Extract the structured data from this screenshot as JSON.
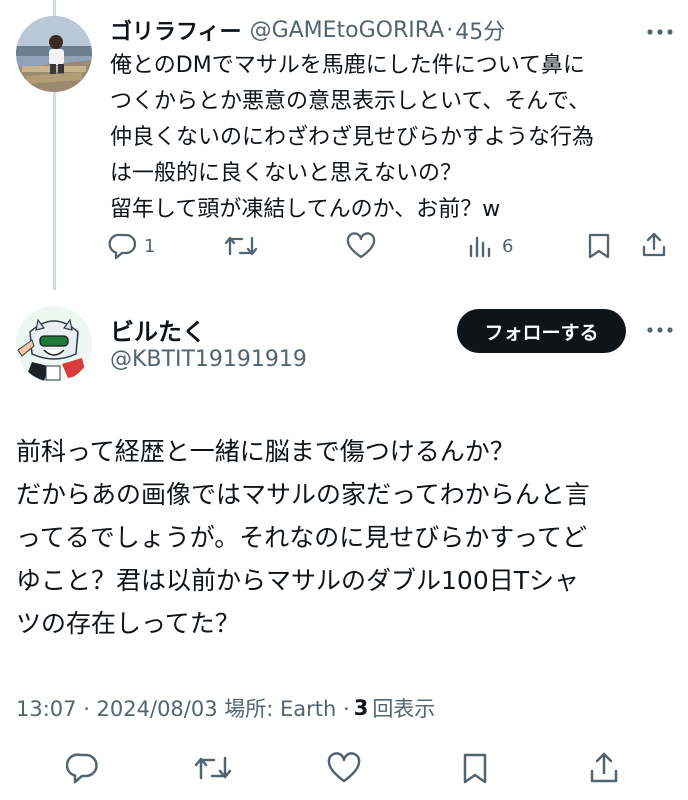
{
  "reply_tweet": {
    "display_name": "ゴリラフィー",
    "handle": "@GAMEtoGORIRA",
    "separator": "·",
    "time": "45分",
    "lines": [
      "俺とのDMでマサルを馬鹿にした件について鼻に",
      "つくからとか悪意の意思表示しといて、そんで、",
      "仲良くないのにわざわざ見せびらかすような行為",
      "は一般的に良くないと思えないの？",
      "留年して頭が凍結してんのか、お前？w"
    ],
    "reply_count": "1",
    "view_count": "6",
    "icons": [
      "reply-icon",
      "retweet-icon",
      "like-icon",
      "views-icon",
      "bookmark-icon",
      "share-icon",
      "more-icon"
    ]
  },
  "main_tweet": {
    "display_name": "ビルたく",
    "handle": "@KBTIT19191919",
    "follow_label": "フォローする",
    "lines": [
      "前科って経歴と一緒に脳まで傷つけるんか？",
      "だからあの画像ではマサルの家だってわからんと言",
      "ってるでしょうが。それなのに見せびらかすってど",
      "ゆこと？君は以前からマサルのダブル100日Tシャ",
      "ツの存在しってた？"
    ],
    "meta_text": "13:07 · 2024/08/03 場所: Earth ·",
    "views_count": "3",
    "views_label": "回表示",
    "icons": [
      "reply-icon",
      "retweet-icon",
      "like-icon",
      "bookmark-icon",
      "share-icon",
      "more-icon"
    ]
  },
  "colors": {
    "text": "#0f1419",
    "secondary": "#536471",
    "thread_line": "#cfd9de",
    "follow_button_bg": "#0f1419",
    "follow_button_text": "#ffffff"
  }
}
